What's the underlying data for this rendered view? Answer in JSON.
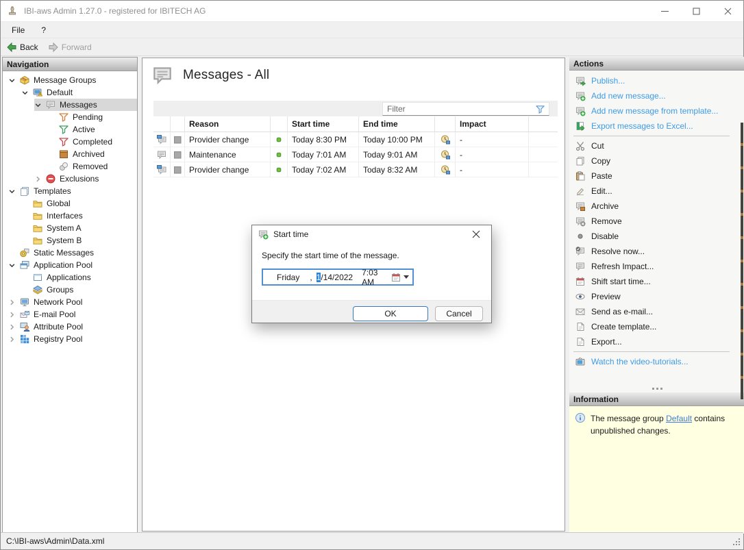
{
  "window": {
    "title": "IBI-aws Admin 1.27.0 - registered for IBITECH AG"
  },
  "menu": {
    "file": "File",
    "help": "?"
  },
  "toolbar": {
    "back": "Back",
    "forward": "Forward"
  },
  "navigation": {
    "header": "Navigation",
    "items": [
      {
        "label": "Message Groups",
        "icon": "message-groups",
        "depth": 0,
        "state": "expanded"
      },
      {
        "label": "Default",
        "icon": "group-default",
        "depth": 1,
        "state": "expanded"
      },
      {
        "label": "Messages",
        "icon": "messages",
        "depth": 2,
        "state": "expanded",
        "selected": true
      },
      {
        "label": "Pending",
        "icon": "funnel-orange",
        "depth": 3,
        "state": "leaf"
      },
      {
        "label": "Active",
        "icon": "funnel-green",
        "depth": 3,
        "state": "leaf"
      },
      {
        "label": "Completed",
        "icon": "funnel-red",
        "depth": 3,
        "state": "leaf"
      },
      {
        "label": "Archived",
        "icon": "archive-box",
        "depth": 3,
        "state": "leaf"
      },
      {
        "label": "Removed",
        "icon": "coins",
        "depth": 3,
        "state": "leaf"
      },
      {
        "label": "Exclusions",
        "icon": "exclusion",
        "depth": 2,
        "state": "collapsed"
      },
      {
        "label": "Templates",
        "icon": "pages",
        "depth": 0,
        "state": "expanded"
      },
      {
        "label": "Global",
        "icon": "folder",
        "depth": 1,
        "state": "leaf"
      },
      {
        "label": "Interfaces",
        "icon": "folder",
        "depth": 1,
        "state": "leaf"
      },
      {
        "label": "System A",
        "icon": "folder",
        "depth": 1,
        "state": "leaf"
      },
      {
        "label": "System B",
        "icon": "folder",
        "depth": 1,
        "state": "leaf"
      },
      {
        "label": "Static Messages",
        "icon": "static-messages",
        "depth": 0,
        "state": "leaf"
      },
      {
        "label": "Application Pool",
        "icon": "application-pool",
        "depth": 0,
        "state": "expanded"
      },
      {
        "label": "Applications",
        "icon": "application-window",
        "depth": 1,
        "state": "leaf"
      },
      {
        "label": "Groups",
        "icon": "group-box",
        "depth": 1,
        "state": "leaf"
      },
      {
        "label": "Network Pool",
        "icon": "network-monitor",
        "depth": 0,
        "state": "collapsed"
      },
      {
        "label": "E-mail Pool",
        "icon": "envelopes",
        "depth": 0,
        "state": "collapsed"
      },
      {
        "label": "Attribute Pool",
        "icon": "person-monitor",
        "depth": 0,
        "state": "collapsed"
      },
      {
        "label": "Registry Pool",
        "icon": "registry-grid",
        "depth": 0,
        "state": "collapsed"
      }
    ]
  },
  "main": {
    "heading": "Messages - All",
    "filter_placeholder": "Filter",
    "table": {
      "columns": {
        "reason": "Reason",
        "start": "Start time",
        "end": "End time",
        "impact": "Impact"
      },
      "rows": [
        {
          "type_icon": "message-monitor",
          "status_icon": "active-green",
          "reason": "Provider change",
          "start": "Today 8:30 PM",
          "end": "Today 10:00 PM",
          "impact_icon": "clock-pending",
          "impact": "-"
        },
        {
          "type_icon": "message",
          "status_icon": "active-green",
          "reason": "Maintenance",
          "start": "Today 7:01 AM",
          "end": "Today 9:01 AM",
          "impact_icon": "clock-pending",
          "impact": "-"
        },
        {
          "type_icon": "message-monitor",
          "status_icon": "active-green",
          "reason": "Provider change",
          "start": "Today 7:02 AM",
          "end": "Today 8:32 AM",
          "impact_icon": "clock-pending",
          "impact": "-"
        }
      ]
    }
  },
  "dialog": {
    "title": "Start time",
    "message": "Specify the start time of the message.",
    "datetime": {
      "day": "Friday",
      "separator": ",",
      "month_selected": "1",
      "date_rest": "/14/2022",
      "time": "7:03 AM"
    },
    "ok_label": "OK",
    "cancel_label": "Cancel"
  },
  "actions": {
    "header": "Actions",
    "items": [
      {
        "label": "Publish...",
        "icon": "message-publish",
        "style": "link"
      },
      {
        "label": "Add new message...",
        "icon": "message-add",
        "style": "link"
      },
      {
        "label": "Add new message from template...",
        "icon": "message-add",
        "style": "link"
      },
      {
        "label": "Export messages to Excel...",
        "icon": "excel-export",
        "style": "link"
      },
      {
        "label": "Cut",
        "icon": "scissors",
        "style": "normal"
      },
      {
        "label": "Copy",
        "icon": "copy-pages",
        "style": "normal"
      },
      {
        "label": "Paste",
        "icon": "clipboard",
        "style": "normal"
      },
      {
        "label": "Edit...",
        "icon": "pencil",
        "style": "normal"
      },
      {
        "label": "Archive",
        "icon": "message-archive",
        "style": "normal"
      },
      {
        "label": "Remove",
        "icon": "message-remove",
        "style": "normal"
      },
      {
        "label": "Disable",
        "icon": "gray-dot",
        "style": "normal"
      },
      {
        "label": "Resolve now...",
        "icon": "message-check",
        "style": "normal"
      },
      {
        "label": "Refresh Impact...",
        "icon": "message-lines",
        "style": "normal"
      },
      {
        "label": "Shift start time...",
        "icon": "calendar",
        "style": "normal"
      },
      {
        "label": "Preview",
        "icon": "eye",
        "style": "normal"
      },
      {
        "label": "Send as e-mail...",
        "icon": "envelope",
        "style": "normal"
      },
      {
        "label": "Create template...",
        "icon": "page",
        "style": "normal"
      },
      {
        "label": "Export...",
        "icon": "page",
        "style": "normal"
      },
      {
        "label": "Watch the video-tutorials...",
        "icon": "tv",
        "style": "link"
      }
    ]
  },
  "information": {
    "header": "Information",
    "text_before": "The message group ",
    "link_text": "Default",
    "text_after": " contains unpublished changes."
  },
  "statusbar": {
    "path": "C:\\IBI-aws\\Admin\\Data.xml"
  },
  "colors": {
    "link_blue": "#3f9be4",
    "info_panel_bg": "#ffffe1",
    "status_green": "#6fc13e",
    "selection_blue": "#2a84dc"
  }
}
